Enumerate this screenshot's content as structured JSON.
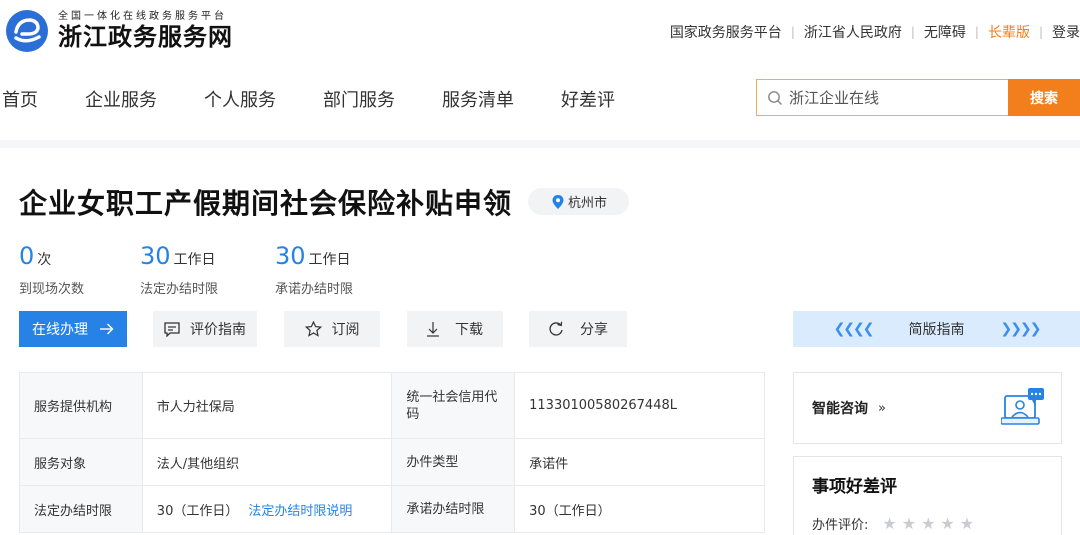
{
  "header": {
    "logo_sub": "全国一体化在线政务服务平台",
    "logo_main": "浙江政务服务网",
    "links": [
      {
        "label": "国家政务服务平台"
      },
      {
        "label": "浙江省人民政府"
      },
      {
        "label": "无障碍"
      },
      {
        "label": "长辈版"
      },
      {
        "label": "登录"
      }
    ]
  },
  "nav": {
    "items": [
      {
        "label": "首页"
      },
      {
        "label": "企业服务"
      },
      {
        "label": "个人服务"
      },
      {
        "label": "部门服务"
      },
      {
        "label": "服务清单"
      },
      {
        "label": "好差评"
      }
    ]
  },
  "search": {
    "value": "浙江企业在线",
    "button": "搜索"
  },
  "page": {
    "title": "企业女职工产假期间社会保险补贴申领",
    "location": "杭州市"
  },
  "stats": [
    {
      "num": "0",
      "unit": "次",
      "label": "到现场次数"
    },
    {
      "num": "30",
      "unit": "工作日",
      "label": "法定办结时限"
    },
    {
      "num": "30",
      "unit": "工作日",
      "label": "承诺办结时限"
    }
  ],
  "actions": {
    "online": "在线办理",
    "evaluate": "评价指南",
    "subscribe": "订阅",
    "download": "下载",
    "share": "分享"
  },
  "guide": {
    "left_chevrons": "❮❮❮❮",
    "label": "简版指南",
    "right_chevrons": "❯❯❯❯"
  },
  "info": {
    "rows": [
      {
        "l1": "服务提供机构",
        "v1": "市人力社保局",
        "l2": "统一社会信用代码",
        "v2": "11330100580267448L"
      },
      {
        "l1": "服务对象",
        "v1": "法人/其他组织",
        "l2": "办件类型",
        "v2": "承诺件"
      },
      {
        "l1": "法定办结时限",
        "v1": "30（工作日）",
        "v1_link": "法定办结时限说明",
        "l2": "承诺办结时限",
        "v2": "30（工作日）"
      }
    ]
  },
  "consult": {
    "label": "智能咨询",
    "arrow": "»"
  },
  "review": {
    "title": "事项好差评",
    "row_label": "办件评价:",
    "stars": 0,
    "max_stars": 5
  },
  "colors": {
    "accent_blue": "#2683e5",
    "accent_orange": "#f27f1b"
  }
}
